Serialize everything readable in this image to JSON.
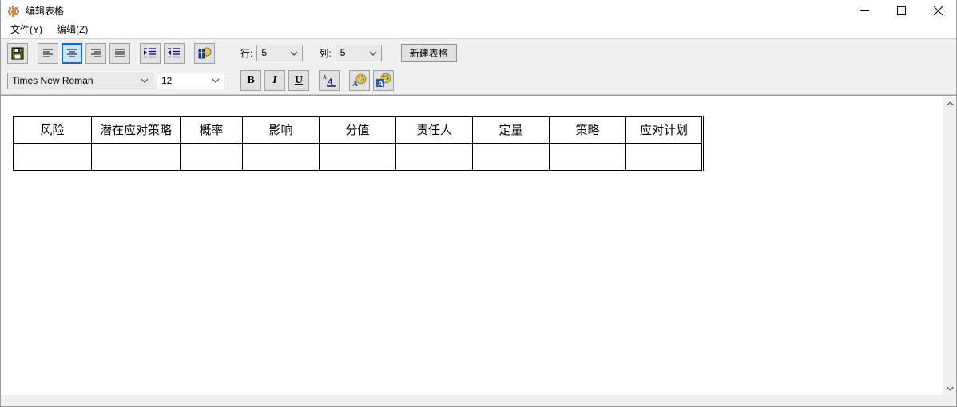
{
  "window": {
    "title": "编辑表格",
    "icon": "flower-app-icon",
    "controls": {
      "minimize": "–",
      "maximize": "□",
      "close": "✕"
    }
  },
  "menubar": {
    "items": [
      {
        "label": "文件",
        "accel": "Y",
        "name": "menu-file"
      },
      {
        "label": "编辑",
        "accel": "Z",
        "name": "menu-edit"
      }
    ]
  },
  "toolbar1": {
    "buttons": [
      {
        "name": "save-button",
        "icon": "floppy-disk-icon",
        "active": false
      },
      {
        "name": "align-left-button",
        "icon": "align-left-icon",
        "active": false
      },
      {
        "name": "align-center-button",
        "icon": "align-center-icon",
        "active": true
      },
      {
        "name": "align-right-button",
        "icon": "align-right-icon",
        "active": false
      },
      {
        "name": "align-justify-button",
        "icon": "align-justify-icon",
        "active": false
      },
      {
        "name": "increase-indent-button",
        "icon": "increase-indent-icon",
        "active": false
      },
      {
        "name": "decrease-indent-button",
        "icon": "decrease-indent-icon",
        "active": false
      },
      {
        "name": "insert-table-button",
        "icon": "table-chart-icon",
        "active": false
      }
    ],
    "rows_label": "行:",
    "rows_value": "5",
    "cols_label": "列:",
    "cols_value": "5",
    "new_table_label": "新建表格"
  },
  "toolbar2": {
    "font_family": "Times New Roman",
    "font_size": "12",
    "bold_label": "B",
    "italic_label": "I",
    "underline_label": "U",
    "font_effect_label": "A",
    "buttons": [
      {
        "name": "bold-button",
        "icon": "bold-icon"
      },
      {
        "name": "italic-button",
        "icon": "italic-icon"
      },
      {
        "name": "underline-button",
        "icon": "underline-icon"
      },
      {
        "name": "font-style-button",
        "icon": "font-letter-a-icon"
      },
      {
        "name": "font-color-button",
        "icon": "palette-font-color-icon"
      },
      {
        "name": "highlight-color-button",
        "icon": "palette-highlight-color-icon"
      }
    ]
  },
  "document": {
    "table": {
      "headers": [
        "风险",
        "潜在应对策略",
        "概率",
        "影响",
        "分值",
        "责任人",
        "定量",
        "策略",
        "应对计划"
      ],
      "rows": [
        [
          "",
          "",
          "",
          "",
          "",
          "",
          "",
          "",
          ""
        ]
      ]
    }
  },
  "scrollbar": {
    "up_arrow": "scroll-up-icon",
    "down_arrow": "scroll-down-icon"
  },
  "colors": {
    "accent": "#0a6cc4",
    "active_fill": "#cce4f7",
    "toolbar_bg": "#f0f0f0",
    "button_face": "#e1e1e1",
    "title_icon": "#e8833a",
    "floppy": "#7a7a00",
    "indent_blue": "#000080",
    "palette_yellow": "#e8c84a"
  }
}
